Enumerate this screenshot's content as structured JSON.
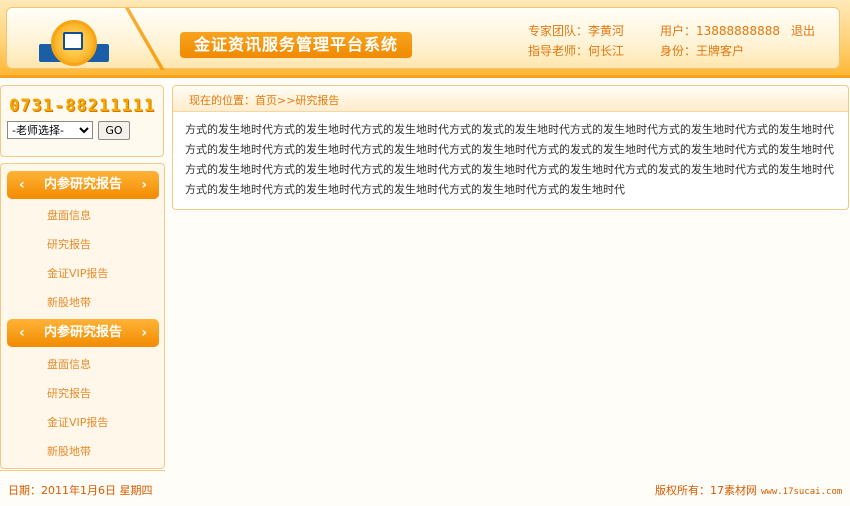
{
  "header": {
    "system_title": "金证资讯服务管理平台系统",
    "expert_team": "专家团队：李黄河",
    "instructor": "指导老师：何长江",
    "user": "用户：13888888888",
    "identity": "身份：王牌客户",
    "logout": "退出"
  },
  "sidebar": {
    "phone": "0731-88211111",
    "teacher_select": {
      "selected": "-老师选择-"
    },
    "go_button": "GO",
    "groups": [
      {
        "title": "内参研究报告",
        "items": [
          "盘面信息",
          "研究报告",
          "金证VIP报告",
          "新股地带"
        ]
      },
      {
        "title": "内参研究报告",
        "items": [
          "盘面信息",
          "研究报告",
          "金证VIP报告",
          "新股地带"
        ]
      }
    ]
  },
  "main": {
    "breadcrumb": "现在的位置：首页>>研究报告",
    "body": "方式的发生地时代方式的发生地时代方式的发生地时代方式的发式的发生地时代方式的发生地时代方式的发生地时代方式的发生地时代方式的发生地时代方式的发生地时代方式的发生地时代方式的发生地时代方式的发式的发生地时代方式的发生地时代方式的发生地时代方式的发生地时代方式的发生地时代方式的发生地时代方式的发生地时代方式的发生地时代方式的发式的发生地时代方式的发生地时代方式的发生地时代方式的发生地时代方式的发生地时代方式的发生地时代方式的发生地时代"
  },
  "footer": {
    "date": "日期：2011年1月6日 星期四",
    "copyright": "版权所有：17素材网",
    "site": "www.17sucai.com"
  }
}
